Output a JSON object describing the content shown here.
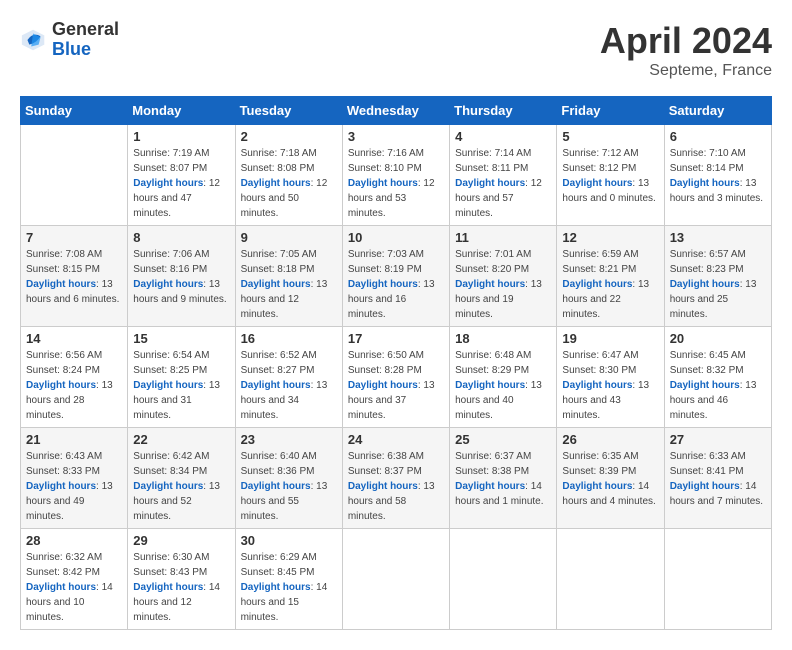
{
  "header": {
    "logo_general": "General",
    "logo_blue": "Blue",
    "month_year": "April 2024",
    "location": "Septeme, France"
  },
  "days_of_week": [
    "Sunday",
    "Monday",
    "Tuesday",
    "Wednesday",
    "Thursday",
    "Friday",
    "Saturday"
  ],
  "weeks": [
    [
      {
        "day": "",
        "sunrise": "",
        "sunset": "",
        "daylight": ""
      },
      {
        "day": "1",
        "sunrise": "Sunrise: 7:19 AM",
        "sunset": "Sunset: 8:07 PM",
        "daylight": "Daylight: 12 hours and 47 minutes."
      },
      {
        "day": "2",
        "sunrise": "Sunrise: 7:18 AM",
        "sunset": "Sunset: 8:08 PM",
        "daylight": "Daylight: 12 hours and 50 minutes."
      },
      {
        "day": "3",
        "sunrise": "Sunrise: 7:16 AM",
        "sunset": "Sunset: 8:10 PM",
        "daylight": "Daylight: 12 hours and 53 minutes."
      },
      {
        "day": "4",
        "sunrise": "Sunrise: 7:14 AM",
        "sunset": "Sunset: 8:11 PM",
        "daylight": "Daylight: 12 hours and 57 minutes."
      },
      {
        "day": "5",
        "sunrise": "Sunrise: 7:12 AM",
        "sunset": "Sunset: 8:12 PM",
        "daylight": "Daylight: 13 hours and 0 minutes."
      },
      {
        "day": "6",
        "sunrise": "Sunrise: 7:10 AM",
        "sunset": "Sunset: 8:14 PM",
        "daylight": "Daylight: 13 hours and 3 minutes."
      }
    ],
    [
      {
        "day": "7",
        "sunrise": "Sunrise: 7:08 AM",
        "sunset": "Sunset: 8:15 PM",
        "daylight": "Daylight: 13 hours and 6 minutes."
      },
      {
        "day": "8",
        "sunrise": "Sunrise: 7:06 AM",
        "sunset": "Sunset: 8:16 PM",
        "daylight": "Daylight: 13 hours and 9 minutes."
      },
      {
        "day": "9",
        "sunrise": "Sunrise: 7:05 AM",
        "sunset": "Sunset: 8:18 PM",
        "daylight": "Daylight: 13 hours and 12 minutes."
      },
      {
        "day": "10",
        "sunrise": "Sunrise: 7:03 AM",
        "sunset": "Sunset: 8:19 PM",
        "daylight": "Daylight: 13 hours and 16 minutes."
      },
      {
        "day": "11",
        "sunrise": "Sunrise: 7:01 AM",
        "sunset": "Sunset: 8:20 PM",
        "daylight": "Daylight: 13 hours and 19 minutes."
      },
      {
        "day": "12",
        "sunrise": "Sunrise: 6:59 AM",
        "sunset": "Sunset: 8:21 PM",
        "daylight": "Daylight: 13 hours and 22 minutes."
      },
      {
        "day": "13",
        "sunrise": "Sunrise: 6:57 AM",
        "sunset": "Sunset: 8:23 PM",
        "daylight": "Daylight: 13 hours and 25 minutes."
      }
    ],
    [
      {
        "day": "14",
        "sunrise": "Sunrise: 6:56 AM",
        "sunset": "Sunset: 8:24 PM",
        "daylight": "Daylight: 13 hours and 28 minutes."
      },
      {
        "day": "15",
        "sunrise": "Sunrise: 6:54 AM",
        "sunset": "Sunset: 8:25 PM",
        "daylight": "Daylight: 13 hours and 31 minutes."
      },
      {
        "day": "16",
        "sunrise": "Sunrise: 6:52 AM",
        "sunset": "Sunset: 8:27 PM",
        "daylight": "Daylight: 13 hours and 34 minutes."
      },
      {
        "day": "17",
        "sunrise": "Sunrise: 6:50 AM",
        "sunset": "Sunset: 8:28 PM",
        "daylight": "Daylight: 13 hours and 37 minutes."
      },
      {
        "day": "18",
        "sunrise": "Sunrise: 6:48 AM",
        "sunset": "Sunset: 8:29 PM",
        "daylight": "Daylight: 13 hours and 40 minutes."
      },
      {
        "day": "19",
        "sunrise": "Sunrise: 6:47 AM",
        "sunset": "Sunset: 8:30 PM",
        "daylight": "Daylight: 13 hours and 43 minutes."
      },
      {
        "day": "20",
        "sunrise": "Sunrise: 6:45 AM",
        "sunset": "Sunset: 8:32 PM",
        "daylight": "Daylight: 13 hours and 46 minutes."
      }
    ],
    [
      {
        "day": "21",
        "sunrise": "Sunrise: 6:43 AM",
        "sunset": "Sunset: 8:33 PM",
        "daylight": "Daylight: 13 hours and 49 minutes."
      },
      {
        "day": "22",
        "sunrise": "Sunrise: 6:42 AM",
        "sunset": "Sunset: 8:34 PM",
        "daylight": "Daylight: 13 hours and 52 minutes."
      },
      {
        "day": "23",
        "sunrise": "Sunrise: 6:40 AM",
        "sunset": "Sunset: 8:36 PM",
        "daylight": "Daylight: 13 hours and 55 minutes."
      },
      {
        "day": "24",
        "sunrise": "Sunrise: 6:38 AM",
        "sunset": "Sunset: 8:37 PM",
        "daylight": "Daylight: 13 hours and 58 minutes."
      },
      {
        "day": "25",
        "sunrise": "Sunrise: 6:37 AM",
        "sunset": "Sunset: 8:38 PM",
        "daylight": "Daylight: 14 hours and 1 minute."
      },
      {
        "day": "26",
        "sunrise": "Sunrise: 6:35 AM",
        "sunset": "Sunset: 8:39 PM",
        "daylight": "Daylight: 14 hours and 4 minutes."
      },
      {
        "day": "27",
        "sunrise": "Sunrise: 6:33 AM",
        "sunset": "Sunset: 8:41 PM",
        "daylight": "Daylight: 14 hours and 7 minutes."
      }
    ],
    [
      {
        "day": "28",
        "sunrise": "Sunrise: 6:32 AM",
        "sunset": "Sunset: 8:42 PM",
        "daylight": "Daylight: 14 hours and 10 minutes."
      },
      {
        "day": "29",
        "sunrise": "Sunrise: 6:30 AM",
        "sunset": "Sunset: 8:43 PM",
        "daylight": "Daylight: 14 hours and 12 minutes."
      },
      {
        "day": "30",
        "sunrise": "Sunrise: 6:29 AM",
        "sunset": "Sunset: 8:45 PM",
        "daylight": "Daylight: 14 hours and 15 minutes."
      },
      {
        "day": "",
        "sunrise": "",
        "sunset": "",
        "daylight": ""
      },
      {
        "day": "",
        "sunrise": "",
        "sunset": "",
        "daylight": ""
      },
      {
        "day": "",
        "sunrise": "",
        "sunset": "",
        "daylight": ""
      },
      {
        "day": "",
        "sunrise": "",
        "sunset": "",
        "daylight": ""
      }
    ]
  ]
}
